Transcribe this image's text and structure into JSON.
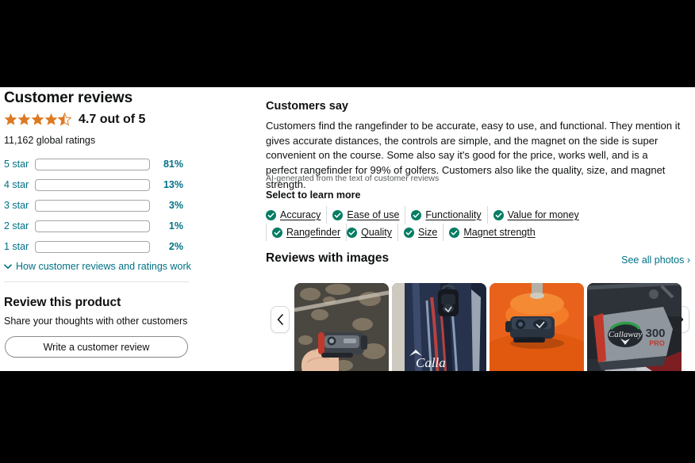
{
  "reviews_panel": {
    "title": "Customer reviews",
    "rating_value": "4.7",
    "rating_text": "4.7 out of 5",
    "stars_filled": 4.5,
    "global_ratings": "11,162 global ratings",
    "histogram": [
      {
        "label": "5 star",
        "percent": "81%",
        "value": 81
      },
      {
        "label": "4 star",
        "percent": "13%",
        "value": 13
      },
      {
        "label": "3 star",
        "percent": "3%",
        "value": 3
      },
      {
        "label": "2 star",
        "percent": "1%",
        "value": 1
      },
      {
        "label": "1 star",
        "percent": "2%",
        "value": 2
      }
    ],
    "how_reviews_work": "How customer reviews and ratings work",
    "review_this_product": "Review this product",
    "share_thoughts": "Share your thoughts with other customers",
    "write_review_button": "Write a customer review"
  },
  "customers_say": {
    "heading": "Customers say",
    "summary": "Customers find the rangefinder to be accurate, easy to use, and functional. They mention it gives accurate distances, the controls are simple, and the magnet on the side is super convenient on the course. Some also say it's good for the price, works well, and is a perfect rangefinder for 99% of golfers. Customers also like the quality, size, and magnet strength.",
    "ai_note": "AI-generated from the text of customer reviews",
    "select_to_learn_more": "Select to learn more",
    "aspects": [
      {
        "label": "Accuracy"
      },
      {
        "label": "Ease of use"
      },
      {
        "label": "Functionality"
      },
      {
        "label": "Value for money"
      },
      {
        "label": "Rangefinder"
      },
      {
        "label": "Quality"
      },
      {
        "label": "Size"
      },
      {
        "label": "Magnet strength"
      }
    ]
  },
  "reviews_with_images": {
    "heading": "Reviews with images",
    "see_all_photos": "See all photos",
    "prev_icon": "chevron-left-icon",
    "next_icon": "chevron-right-icon",
    "thumbnails": [
      {
        "alt": "Hand holding black and red rangefinder over asphalt"
      },
      {
        "alt": "Rangefinder clipped to navy Callaway golf bag"
      },
      {
        "alt": "Rangefinder magnetically attached to an orange cone"
      },
      {
        "alt": "Close-up of Callaway 300 PRO rangefinder on cart"
      }
    ]
  },
  "colors": {
    "star": "#DE7921",
    "bar_fill": "#DE7921",
    "link": "#007185",
    "check_green": "#067D62",
    "text": "#0F1111",
    "muted": "#565959"
  }
}
